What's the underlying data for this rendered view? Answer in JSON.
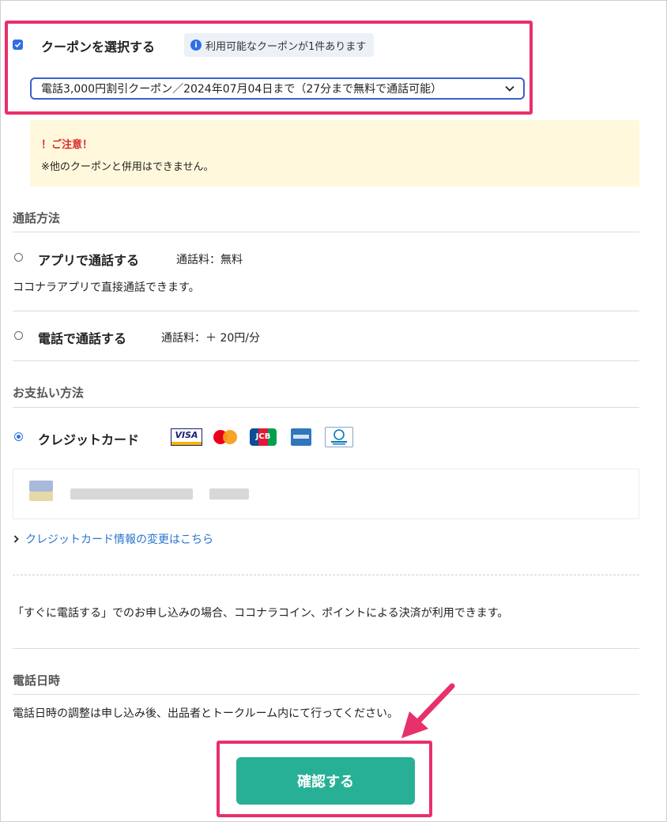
{
  "coupon": {
    "title": "クーポンを選択する",
    "info_text": "利用可能なクーポンが1件あります",
    "selected": "電話3,000円割引クーポン／2024年07月04日まで（27分まで無料で通話可能）"
  },
  "notice": {
    "title": "！ご注意！",
    "text": "※他のクーポンと併用はできません。"
  },
  "call_method": {
    "heading": "通話方法",
    "app_label": "アプリで通話する",
    "app_fee": "通話料：無料",
    "app_desc": "ココナラアプリで直接通話できます。",
    "phone_label": "電話で通話する",
    "phone_fee": "通話料：＋ 20円/分"
  },
  "payment": {
    "heading": "お支払い方法",
    "credit_label": "クレジットカード",
    "visa": "VISA",
    "jcb": "JCB",
    "change_link": "クレジットカード情報の変更はこちら",
    "note": "「すぐに電話する」でのお申し込みの場合、ココナラコイン、ポイントによる決済が利用できます。"
  },
  "call_datetime": {
    "heading": "電話日時",
    "text": "電話日時の調整は申し込み後、出品者とトークルーム内にて行ってください。"
  },
  "confirm_label": "確認する",
  "colors": {
    "highlight": "#e8306a",
    "button": "#28b096",
    "link": "#2a74cf",
    "notice_bg": "#fff8dc",
    "accent": "#2f6fe6"
  }
}
